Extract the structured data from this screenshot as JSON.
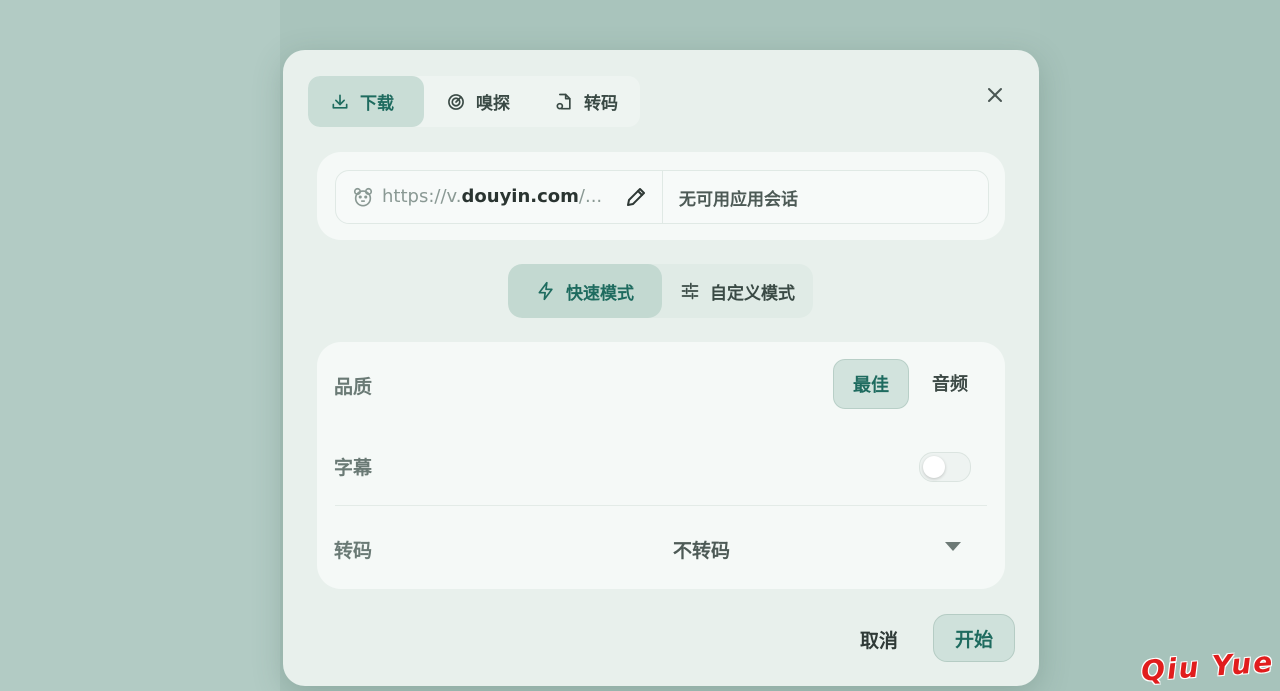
{
  "tabs": [
    {
      "label": "下载",
      "icon": "download-icon",
      "active": true
    },
    {
      "label": "嗅探",
      "icon": "radar-icon",
      "active": false
    },
    {
      "label": "转码",
      "icon": "file-convert-icon",
      "active": false
    }
  ],
  "url": {
    "prefix": "https://v.",
    "domain": "douyin.com",
    "suffix": "/...",
    "session": "无可用应用会话"
  },
  "modes": [
    {
      "label": "快速模式",
      "icon": "lightning-icon",
      "active": true
    },
    {
      "label": "自定义模式",
      "icon": "sliders-icon",
      "active": false
    }
  ],
  "options": {
    "quality": {
      "label": "品质",
      "choices": [
        "最佳",
        "音频"
      ],
      "selected": "最佳"
    },
    "subtitle": {
      "label": "字幕",
      "enabled": false
    },
    "transcode": {
      "label": "转码",
      "value": "不转码"
    }
  },
  "footer": {
    "cancel": "取消",
    "start": "开始"
  },
  "watermark": "Qiu Yue",
  "colors": {
    "accent": "#1e6b5f",
    "dialog_bg": "#e8f0ec",
    "card_bg": "#f5f9f7",
    "watermark": "#e11d1d"
  }
}
